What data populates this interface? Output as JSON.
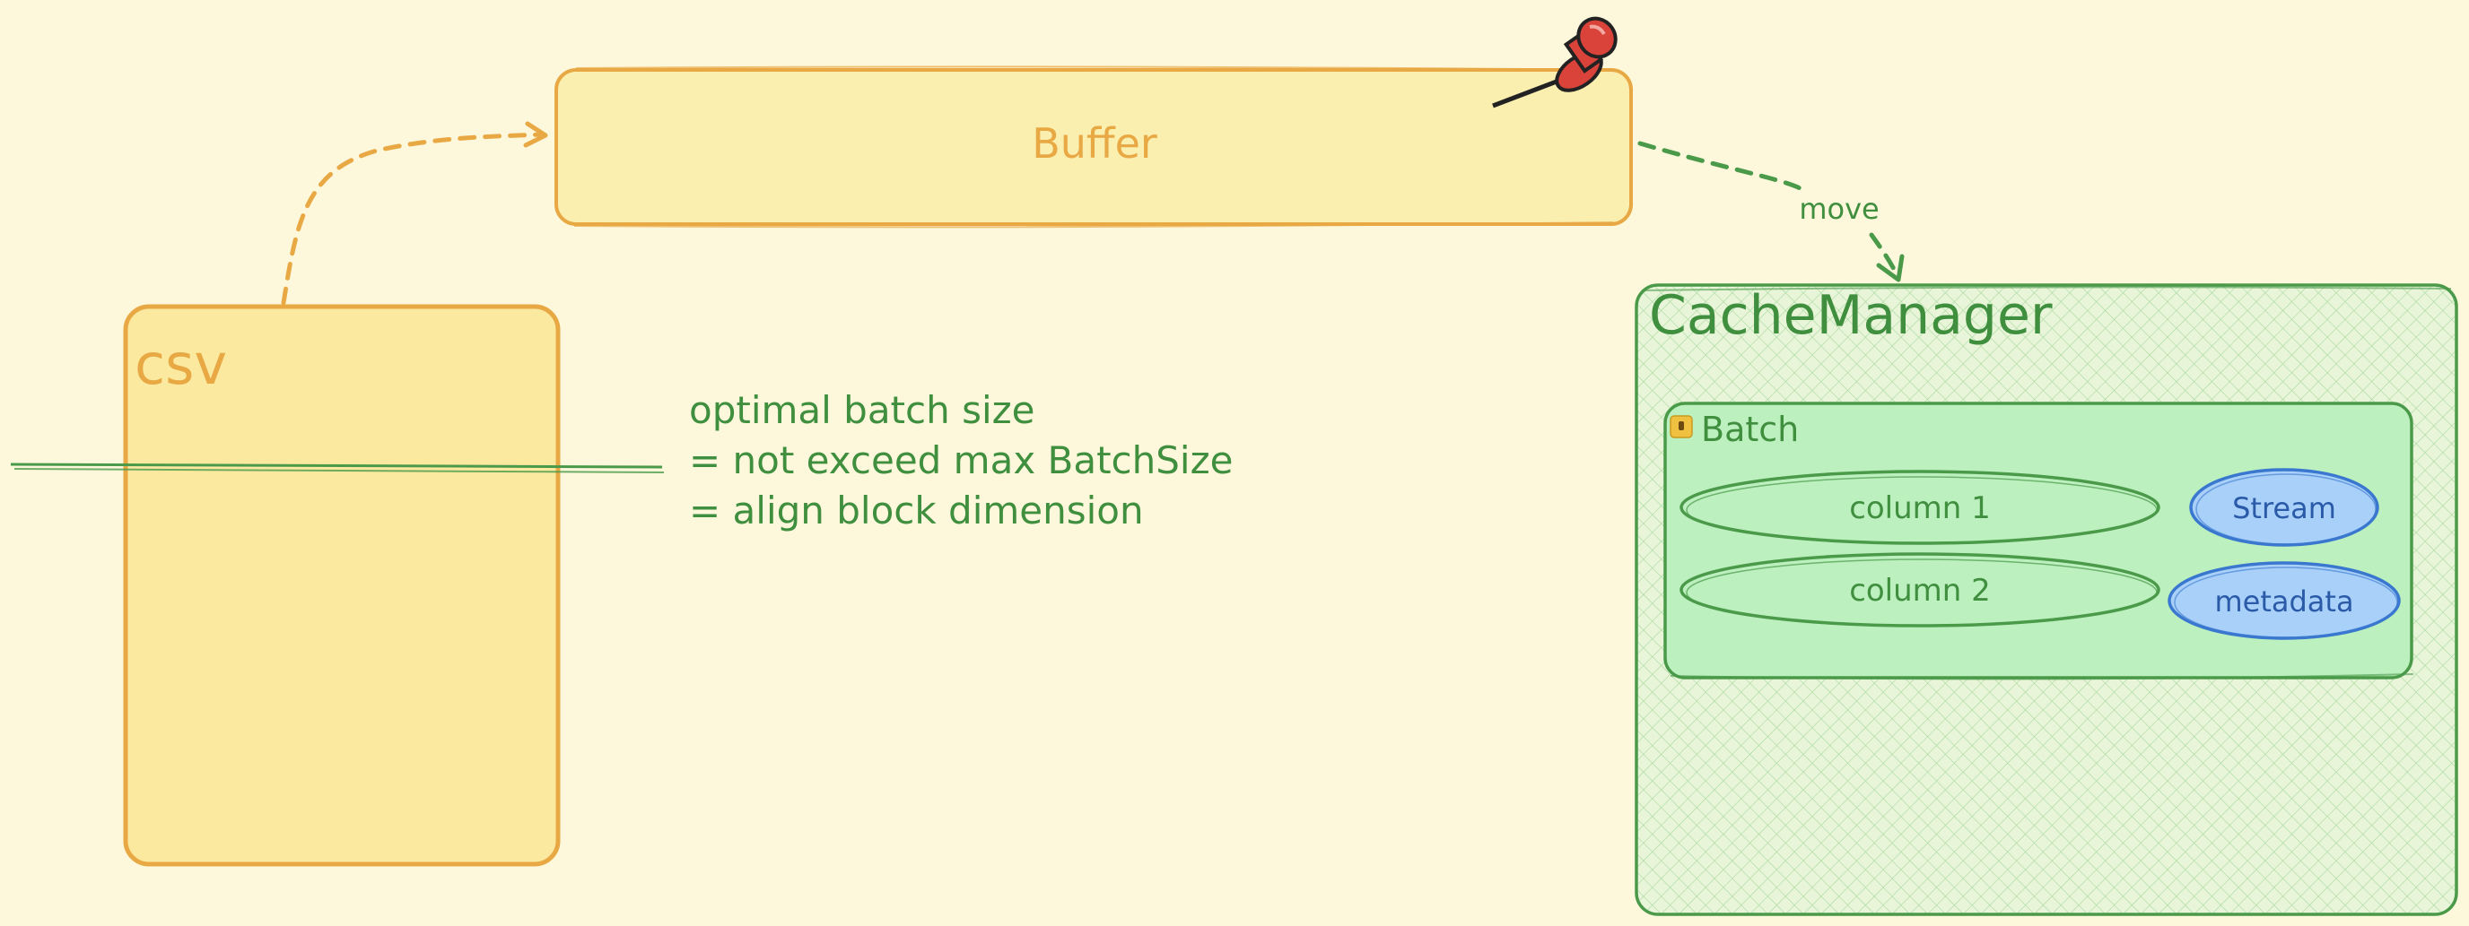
{
  "nodes": {
    "buffer": {
      "label": "Buffer"
    },
    "csv": {
      "label": "csv"
    },
    "cache_manager": {
      "label": "CacheManager"
    },
    "batch": {
      "label": "Batch",
      "columns": [
        "column 1",
        "column 2"
      ],
      "tags": [
        "Stream",
        "metadata"
      ]
    }
  },
  "edges": {
    "move_label": "move"
  },
  "note": {
    "lines": [
      "optimal batch size",
      "= not exceed max BatchSize",
      "= align block dimension"
    ]
  },
  "colors": {
    "background": "#fdf8dc",
    "orange_stroke": "#e8a844",
    "orange_fill": "#fbefb0",
    "csv_fill": "#fce9a0",
    "green_stroke": "#4a9a4a",
    "green_fill": "#bdf0bf",
    "green_text": "#3f8f3f",
    "blue_stroke": "#3a78d0",
    "blue_fill": "#a8d0f8",
    "blue_text": "#2a5aa8",
    "pin_red": "#d9433a"
  },
  "icons": {
    "pin": "pushpin-icon",
    "lock": "lock-icon"
  }
}
